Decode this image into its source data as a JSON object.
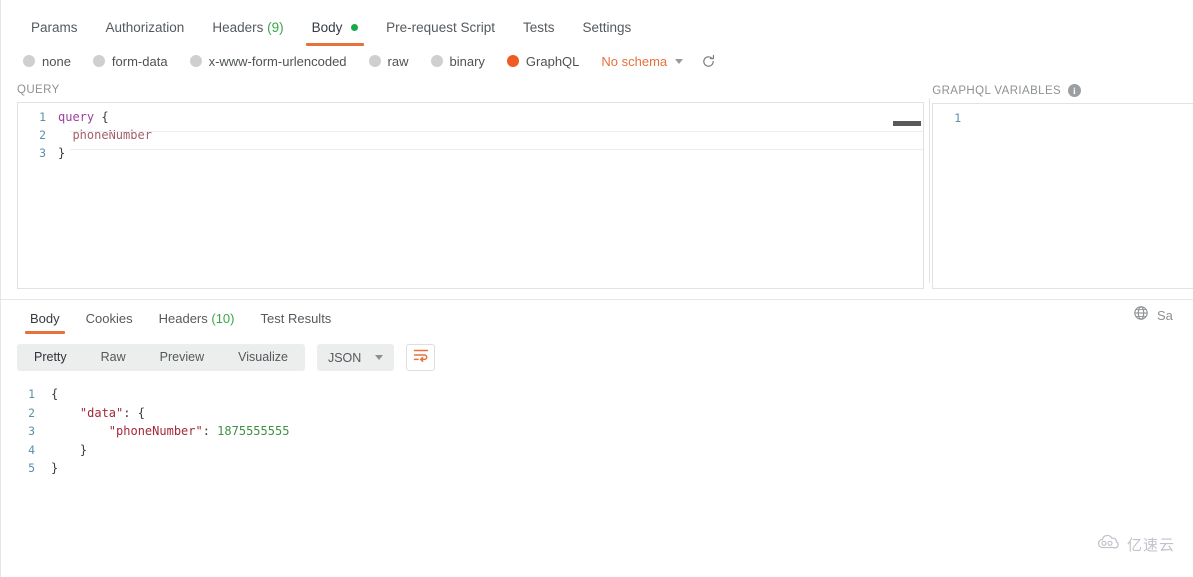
{
  "request": {
    "tabs": [
      {
        "label": "Params",
        "active": false
      },
      {
        "label": "Authorization",
        "active": false
      },
      {
        "label": "Headers",
        "count": "(9)",
        "active": false
      },
      {
        "label": "Body",
        "active": true,
        "dot": "green-dot"
      },
      {
        "label": "Pre-request Script",
        "active": false
      },
      {
        "label": "Tests",
        "active": false
      },
      {
        "label": "Settings",
        "active": false
      }
    ],
    "body_types": [
      {
        "label": "none",
        "selected": false
      },
      {
        "label": "form-data",
        "selected": false
      },
      {
        "label": "x-www-form-urlencoded",
        "selected": false
      },
      {
        "label": "raw",
        "selected": false
      },
      {
        "label": "binary",
        "selected": false
      },
      {
        "label": "GraphQL",
        "selected": true
      }
    ],
    "schema_label": "No schema",
    "schema_caret_icon": "chevron-down-icon",
    "refresh_icon": "refresh-icon"
  },
  "query_pane": {
    "label": "QUERY",
    "lines": [
      {
        "n": "1",
        "kw": "query",
        "punc": " {"
      },
      {
        "n": "2",
        "field": "  phoneNumber"
      },
      {
        "n": "3",
        "punc": "}"
      }
    ]
  },
  "variables_pane": {
    "label": "GRAPHQL VARIABLES",
    "info_icon": "info-icon",
    "info_glyph": "i",
    "lines": [
      {
        "n": "1",
        "text": ""
      }
    ]
  },
  "response": {
    "tabs": [
      {
        "label": "Body",
        "active": true
      },
      {
        "label": "Cookies",
        "active": false
      },
      {
        "label": "Headers",
        "count": "(10)",
        "active": false
      },
      {
        "label": "Test Results",
        "active": false
      }
    ],
    "globe_icon": "globe-icon",
    "save_response_label": "Sa",
    "format_tabs": [
      {
        "label": "Pretty",
        "active": true
      },
      {
        "label": "Raw",
        "active": false
      },
      {
        "label": "Preview",
        "active": false
      },
      {
        "label": "Visualize",
        "active": false
      }
    ],
    "format_select": {
      "value": "JSON",
      "caret_icon": "chevron-down-icon"
    },
    "wrap_button_icon": "wrap-text-icon",
    "body_lines": [
      {
        "n": "1",
        "punc": "{"
      },
      {
        "n": "2",
        "key": "    \"data\"",
        "punc": ": {"
      },
      {
        "n": "3",
        "key": "        \"phoneNumber\"",
        "punc": ": ",
        "num": "1875555555"
      },
      {
        "n": "4",
        "punc": "    }"
      },
      {
        "n": "5",
        "punc": "}"
      }
    ]
  },
  "watermark": {
    "text": "亿速云",
    "icon": "cloud-icon"
  },
  "colors": {
    "accent": "#e8703a",
    "graphql_selected": "#ef5b25",
    "green": "#17a94b",
    "count_green": "#3aa548",
    "json_key": "#a4283a",
    "json_number": "#3f9142",
    "keyword": "#9b3fa0",
    "field": "#a0616b",
    "line_number": "#5a91a8"
  }
}
